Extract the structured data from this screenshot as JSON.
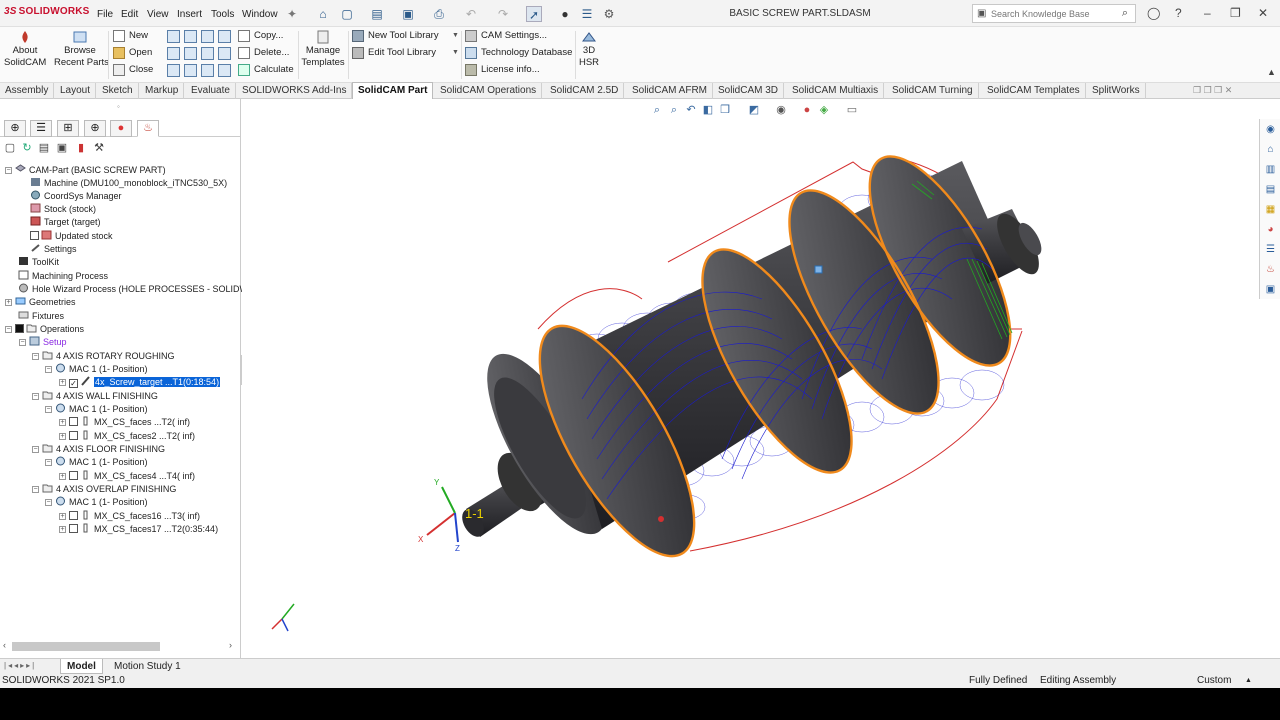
{
  "app": {
    "brand": "SOLIDWORKS",
    "document_title": "BASIC SCREW PART.SLDASM"
  },
  "menu": [
    "File",
    "Edit",
    "View",
    "Insert",
    "Tools",
    "Window"
  ],
  "search": {
    "placeholder": "Search Knowledge Base"
  },
  "ribbon": {
    "about": "About\nSolidCAM",
    "browse": "Browse\nRecent Parts",
    "new": "New",
    "open": "Open",
    "close": "Close",
    "copy": "Copy...",
    "delete": "Delete...",
    "calculate": "Calculate",
    "manage_templates": "Manage\nTemplates",
    "new_tool_library": "New Tool Library",
    "edit_tool_library": "Edit Tool Library",
    "cam_settings": "CAM Settings...",
    "technology_database": "Technology Database",
    "license_info": "License info...",
    "hsr": "3D\nHSR"
  },
  "tabs": [
    "Assembly",
    "Layout",
    "Sketch",
    "Markup",
    "Evaluate",
    "SOLIDWORKS Add-Ins",
    "SolidCAM Part",
    "SolidCAM Operations",
    "SolidCAM 2.5D",
    "SolidCAM AFRM",
    "SolidCAM 3D",
    "SolidCAM Multiaxis",
    "SolidCAM Turning",
    "SolidCAM Templates",
    "SplitWorks"
  ],
  "active_tab": "SolidCAM Part",
  "tree": {
    "root": "CAM-Part (BASIC SCREW PART)",
    "machine": "Machine (DMU100_monoblock_iTNC530_5X)",
    "coordsys": "CoordSys Manager",
    "stock": "Stock (stock)",
    "target": "Target (target)",
    "updated_stock": "Updated stock",
    "settings": "Settings",
    "toolkit": "ToolKit",
    "machining_process": "Machining Process",
    "hole_wizard": "Hole Wizard Process (HOLE PROCESSES - SOLIDWORI",
    "geometries": "Geometries",
    "fixtures": "Fixtures",
    "operations": "Operations",
    "setup": "Setup",
    "group1": "4 AXIS ROTARY ROUGHING",
    "mac1a": "MAC 1 (1- Position)",
    "op1": "4x_Screw_target ...T1(0:18:54)",
    "group2": "4 AXIS WALL FINISHING",
    "mac1b": "MAC 1 (1- Position)",
    "op2": "MX_CS_faces ...T2( inf)",
    "op3": "MX_CS_faces2 ...T2( inf)",
    "group3": "4 AXIS FLOOR FINISHING",
    "mac1c": "MAC 1 (1- Position)",
    "op4": "MX_CS_faces4 ...T4( inf)",
    "group4": "4 AXIS OVERLAP FINISHING",
    "mac1d": "MAC 1 (1- Position)",
    "op5": "MX_CS_faces16 ...T3( inf)",
    "op6": "MX_CS_faces17 ...T2(0:35:44)"
  },
  "viewport": {
    "position_label": "1-1",
    "triad_x": "X",
    "triad_y": "Y",
    "triad_z": "Z"
  },
  "bottom_tabs": [
    "Model",
    "Motion Study 1"
  ],
  "status": {
    "version": "SOLIDWORKS 2021 SP1.0",
    "defined": "Fully Defined",
    "mode": "Editing Assembly",
    "units": "Custom"
  },
  "colors": {
    "accent": "#0a64d8",
    "brand": "#c8102e",
    "toolpath": "#1a1ad0",
    "contour": "#f08a1c",
    "boundary": "#d43030",
    "fixture": "#22aa22"
  }
}
